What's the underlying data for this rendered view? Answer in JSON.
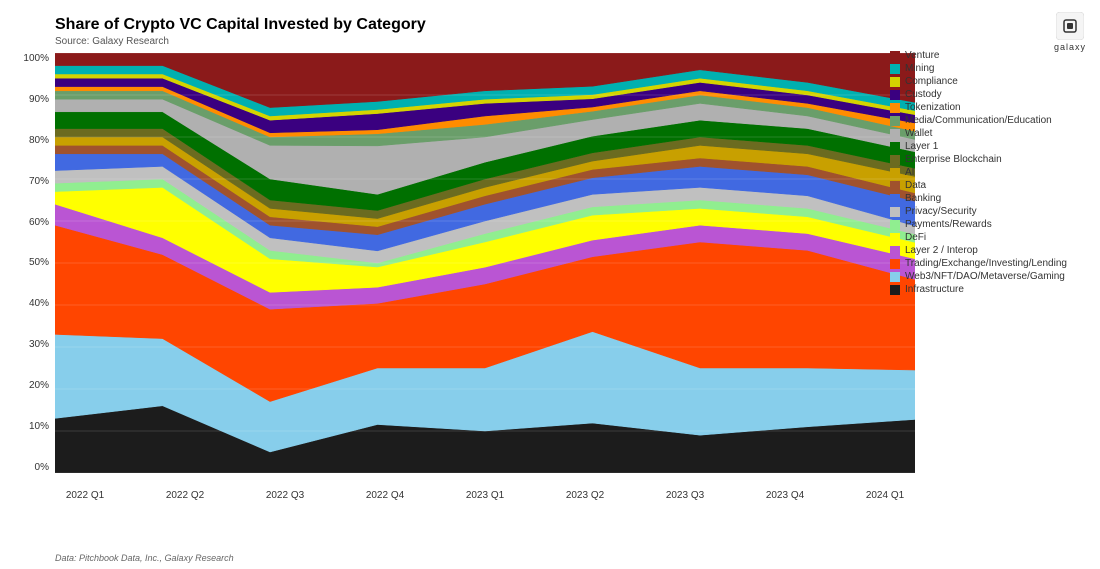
{
  "title": "Share of Crypto VC Capital Invested by Category",
  "source_label": "Source: Galaxy Research",
  "footer_source": "Data: Pitchbook Data, Inc., Galaxy Research",
  "y_labels": [
    "0%",
    "10%",
    "20%",
    "30%",
    "40%",
    "50%",
    "60%",
    "70%",
    "80%",
    "90%",
    "100%"
  ],
  "x_labels": [
    "2022 Q1",
    "2022 Q2",
    "2022 Q3",
    "2022 Q4",
    "2023 Q1",
    "2023 Q2",
    "2023 Q3",
    "2023 Q4",
    "2024 Q1"
  ],
  "galaxy_text": "galaxy",
  "legend": [
    {
      "label": "Venture",
      "color": "#8B1A1A"
    },
    {
      "label": "Mining",
      "color": "#00B0B0"
    },
    {
      "label": "Compliance",
      "color": "#D4D400"
    },
    {
      "label": "Custody",
      "color": "#3A0080"
    },
    {
      "label": "Tokenization",
      "color": "#FF8C00"
    },
    {
      "label": "Media/Communication/Education",
      "color": "#6A9E6A"
    },
    {
      "label": "Wallet",
      "color": "#B0B0B0"
    },
    {
      "label": "Layer 1",
      "color": "#007000"
    },
    {
      "label": "Enterprise Blockchain",
      "color": "#6B6B20"
    },
    {
      "label": "AI",
      "color": "#C8A000"
    },
    {
      "label": "Data",
      "color": "#A0522D"
    },
    {
      "label": "Banking",
      "color": "#4169E1"
    },
    {
      "label": "Privacy/Security",
      "color": "#C0C0C0"
    },
    {
      "label": "Payments/Rewards",
      "color": "#90EE90"
    },
    {
      "label": "DeFi",
      "color": "#FFFF00"
    },
    {
      "label": "Layer 2 / Interop",
      "color": "#BA55D3"
    },
    {
      "label": "Trading/Exchange/Investing/Lending",
      "color": "#FF4500"
    },
    {
      "label": "Web3/NFT/DAO/Metaverse/Gaming",
      "color": "#87CEEB"
    },
    {
      "label": "Infrastructure",
      "color": "#1C1C1C"
    }
  ]
}
